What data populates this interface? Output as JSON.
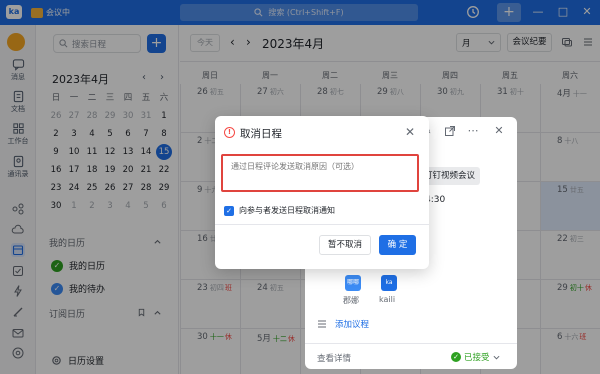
{
  "titlebar": {
    "logo": "ka",
    "tab_label": "会议中",
    "search_placeholder": "搜索 (Ctrl+Shift+F)",
    "add_label": "+",
    "minimize": "—",
    "maximize": "□",
    "close": "✕",
    "accent": "#1f6fe5"
  },
  "rail": {
    "items": [
      {
        "label": "消息",
        "icon": "message-icon"
      },
      {
        "label": "文档",
        "icon": "document-icon"
      },
      {
        "label": "工作台",
        "icon": "workbench-icon"
      },
      {
        "label": "通讯录",
        "icon": "contacts-icon"
      }
    ]
  },
  "sidebar": {
    "search_placeholder": "搜索日程",
    "add": "+",
    "mini_title": "2023年4月",
    "prev": "‹",
    "next": "›",
    "weekdays": [
      "日",
      "一",
      "二",
      "三",
      "四",
      "五",
      "六"
    ],
    "weeks": [
      [
        "26",
        "27",
        "28",
        "29",
        "30",
        "31",
        "1"
      ],
      [
        "2",
        "3",
        "4",
        "5",
        "6",
        "7",
        "8"
      ],
      [
        "9",
        "10",
        "11",
        "12",
        "13",
        "14",
        "15"
      ],
      [
        "16",
        "17",
        "18",
        "19",
        "20",
        "21",
        "22"
      ],
      [
        "23",
        "24",
        "25",
        "26",
        "27",
        "28",
        "29"
      ],
      [
        "30",
        "1",
        "2",
        "3",
        "4",
        "5",
        "6"
      ]
    ],
    "today": "15",
    "my_calendars_label": "我的日历",
    "my_calendar": "我的日历",
    "my_todo": "我的待办",
    "subscribed_label": "订阅日历",
    "settings": "日历设置"
  },
  "toolbar": {
    "today": "今天",
    "prev": "‹",
    "next": "›",
    "month_title": "2023年4月",
    "view": "月",
    "minutes": "会议纪要"
  },
  "grid": {
    "weekdays": [
      "周日",
      "周一",
      "周二",
      "周三",
      "周四",
      "周五",
      "周六"
    ],
    "rows": [
      [
        {
          "d": "26",
          "s": "初五"
        },
        {
          "d": "27",
          "s": "初六"
        },
        {
          "d": "28",
          "s": "初七"
        },
        {
          "d": "29",
          "s": "初八"
        },
        {
          "d": "30",
          "s": "初九"
        },
        {
          "d": "31",
          "s": "初十"
        },
        {
          "d": "4月",
          "s": "十一"
        }
      ],
      [
        {
          "d": "2",
          "s": "十二"
        },
        {
          "d": "",
          "s": ""
        },
        {
          "d": "",
          "s": ""
        },
        {
          "d": "",
          "s": ""
        },
        {
          "d": "",
          "s": ""
        },
        {
          "d": "",
          "s": ""
        },
        {
          "d": "8",
          "s": "十八"
        }
      ],
      [
        {
          "d": "9",
          "s": "十九"
        },
        {
          "d": "",
          "s": ""
        },
        {
          "d": "",
          "s": ""
        },
        {
          "d": "",
          "s": ""
        },
        {
          "d": "",
          "s": ""
        },
        {
          "d": "",
          "s": ""
        },
        {
          "d": "15",
          "s": "廿五"
        }
      ],
      [
        {
          "d": "16",
          "s": "廿六"
        },
        {
          "d": "",
          "s": ""
        },
        {
          "d": "",
          "s": ""
        },
        {
          "d": "",
          "s": ""
        },
        {
          "d": "",
          "s": ""
        },
        {
          "d": "",
          "s": ""
        },
        {
          "d": "22",
          "s": "初三"
        }
      ],
      [
        {
          "d": "23",
          "s": "初四",
          "tag": "班"
        },
        {
          "d": "24",
          "s": "初五"
        },
        {
          "d": "",
          "s": ""
        },
        {
          "d": "",
          "s": ""
        },
        {
          "d": "",
          "s": ""
        },
        {
          "d": "",
          "s": ""
        },
        {
          "d": "29",
          "s": "初十",
          "tag": "休"
        }
      ],
      [
        {
          "d": "30",
          "s": "十一",
          "tag": "休"
        },
        {
          "d": "5月",
          "s": "十二",
          "tag": "休"
        },
        {
          "d": "",
          "s": ""
        },
        {
          "d": "",
          "s": ""
        },
        {
          "d": "",
          "s": ""
        },
        {
          "d": "",
          "s": ""
        },
        {
          "d": "6",
          "s": "十六",
          "tag": "班"
        }
      ]
    ]
  },
  "popover": {
    "event_title": "钉钉视频会议",
    "time": "4:30",
    "attendees": [
      {
        "avatar": "哪哪",
        "name": "郡娜"
      },
      {
        "avatar": "ka",
        "name": "kaili"
      }
    ],
    "add_agenda": "添加议程",
    "view_details": "查看详情",
    "status": "已接受"
  },
  "dialog": {
    "title": "取消日程",
    "close": "✕",
    "reason_placeholder": "通过日程评论发送取消原因（可选）",
    "notify_label": "向参与者发送日程取消通知",
    "notify_checked": true,
    "cancel_button": "暂不取消",
    "confirm_button": "确 定",
    "warn_color": "#f54a45"
  }
}
